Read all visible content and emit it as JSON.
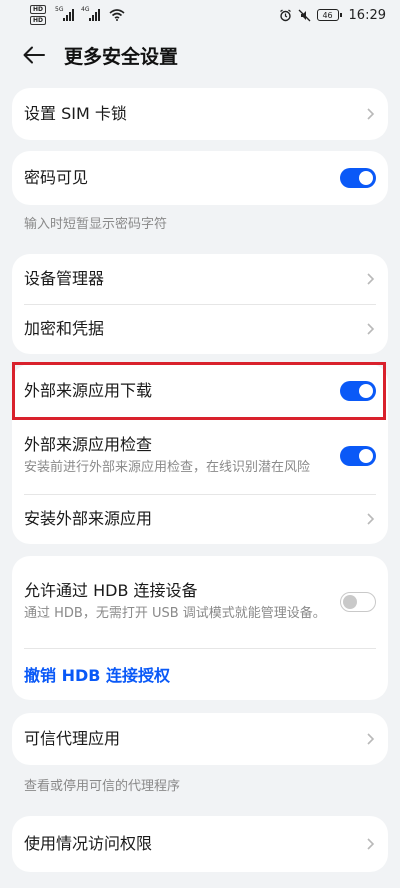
{
  "status_bar": {
    "sim1": "HD",
    "sim2": "HD",
    "net1": "5G",
    "net2": "4G",
    "battery": "46",
    "time": "16:29"
  },
  "header": {
    "title": "更多安全设置"
  },
  "items": {
    "sim_lock": "设置 SIM 卡锁",
    "password_visible": "密码可见",
    "password_visible_note": "输入时短暂显示密码字符",
    "device_admin": "设备管理器",
    "encryption": "加密和凭据",
    "external_download": "外部来源应用下载",
    "external_check": "外部来源应用检查",
    "external_check_sub": "安装前进行外部来源应用检查，在线识别潜在风险",
    "install_external": "安装外部来源应用",
    "hdb_allow": "允许通过 HDB 连接设备",
    "hdb_allow_sub": "通过 HDB，无需打开 USB 调试模式就能管理设备。",
    "hdb_revoke": "撤销 HDB 连接授权",
    "trust_agents": "可信代理应用",
    "trust_agents_note": "查看或停用可信的代理程序",
    "usage_access": "使用情况访问权限"
  },
  "toggles": {
    "password_visible": "on",
    "external_download": "on",
    "external_check": "on",
    "hdb_allow": "off"
  },
  "colors": {
    "accent": "#0a59f7",
    "highlight": "#d9212c",
    "background": "#f1f3f5"
  }
}
